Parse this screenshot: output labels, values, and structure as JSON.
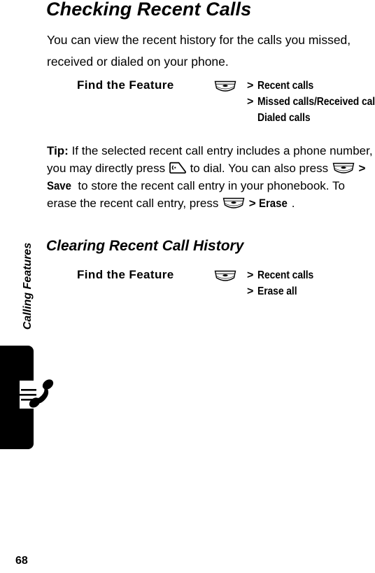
{
  "document": {
    "page_number": "68",
    "side_tab_label": "Calling Features",
    "side_tab_icon": "phone-handset-icon"
  },
  "title": "Checking Recent Calls",
  "intro": "You can view the recent history for the calls you missed, received or dialed on your phone.",
  "find_feature_1": {
    "label": "Find the Feature",
    "rows": [
      {
        "icon": "menu-key-icon",
        "separator": ">",
        "text": "Recent calls"
      },
      {
        "icon": "",
        "separator": ">",
        "text": "Missed calls/Received calls/"
      },
      {
        "icon": "",
        "separator": "",
        "text": "Dialed calls"
      }
    ]
  },
  "tip": {
    "lead": "Tip:",
    "part1": " If the selected recent call entry includes a phone number, you may directly press ",
    "send_key_icon": "send-key-icon",
    "part2": " to dial. You can also press ",
    "menu_key_icon_1": "menu-key-icon",
    "gt1": " > ",
    "save_label": "Save",
    "part3": " to store the recent call entry in your phonebook. To erase the recent call entry, press ",
    "menu_key_icon_2": "menu-key-icon",
    "gt2": " > ",
    "erase_label": "Erase",
    "part4": "."
  },
  "section_title": "Clearing Recent Call History",
  "find_feature_2": {
    "label": "Find the Feature",
    "rows": [
      {
        "icon": "menu-key-icon",
        "separator": ">",
        "text": "Recent calls"
      },
      {
        "icon": "",
        "separator": ">",
        "text": "Erase all"
      }
    ]
  },
  "colors": {
    "text": "#000000",
    "background": "#ffffff",
    "tab": "#000000"
  }
}
